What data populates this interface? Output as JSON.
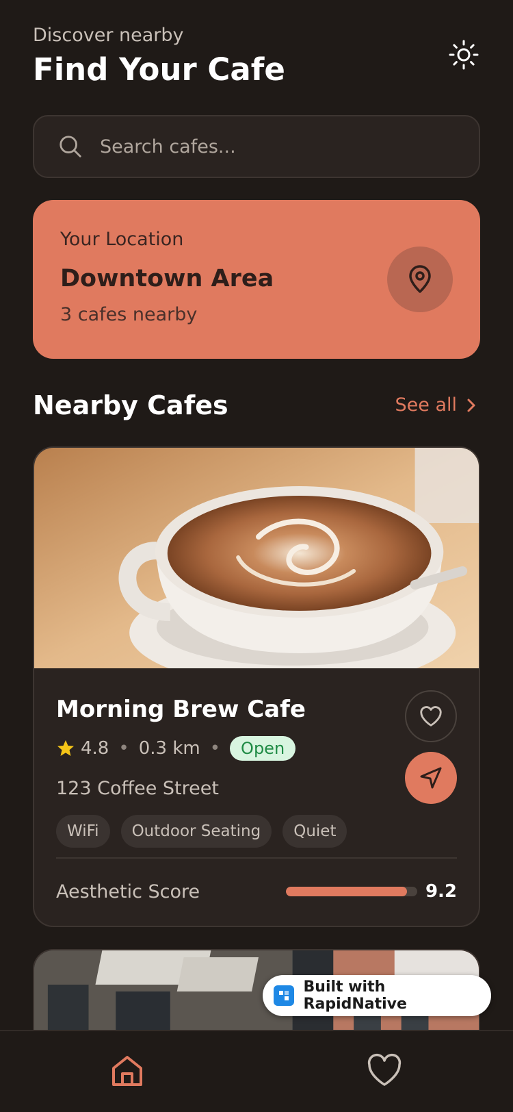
{
  "header": {
    "subtitle": "Discover nearby",
    "title": "Find Your Cafe",
    "theme_icon": "sun-icon"
  },
  "search": {
    "placeholder": "Search cafes...",
    "value": "",
    "icon": "search-icon"
  },
  "location": {
    "label": "Your Location",
    "name": "Downtown Area",
    "count": "3 cafes nearby",
    "icon": "map-pin-icon"
  },
  "nearby": {
    "title": "Nearby Cafes",
    "see_all": "See all"
  },
  "cafes": [
    {
      "name": "Morning Brew Cafe",
      "rating": "4.8",
      "distance": "0.3 km",
      "status": "Open",
      "address": "123 Coffee Street",
      "tags": [
        "WiFi",
        "Outdoor Seating",
        "Quiet"
      ],
      "score_label": "Aesthetic Score",
      "score": "9.2",
      "score_fraction": 0.92
    }
  ],
  "badge": {
    "text": "Built with RapidNative"
  },
  "tabs": [
    {
      "icon": "home-icon",
      "active": true
    },
    {
      "icon": "heart-icon",
      "active": false
    }
  ],
  "colors": {
    "background": "#1f1a17",
    "accent": "#e07a5f",
    "card": "#2a2320",
    "open_badge_bg": "#d8f5e0",
    "open_badge_text": "#1f8b45",
    "star": "#f5c518"
  }
}
